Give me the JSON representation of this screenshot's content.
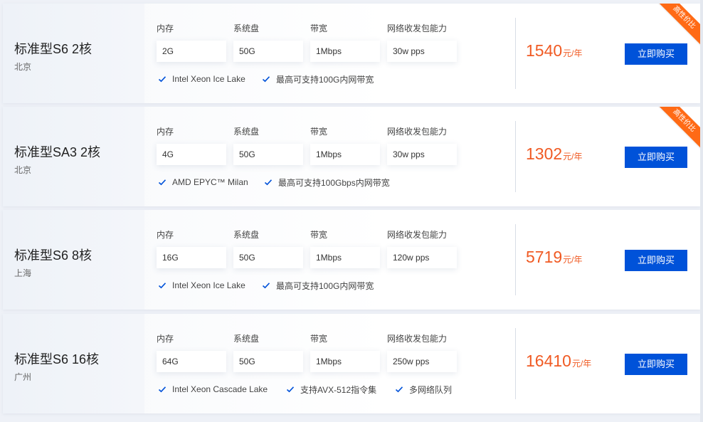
{
  "plans": [
    {
      "name": "标准型S6 2核",
      "region": "北京",
      "specs": [
        {
          "label": "内存",
          "value": "2G"
        },
        {
          "label": "系统盘",
          "value": "50G"
        },
        {
          "label": "带宽",
          "value": "1Mbps"
        },
        {
          "label": "网络收发包能力",
          "value": "30w pps"
        }
      ],
      "features": [
        "Intel Xeon Ice Lake",
        "最高可支持100G内网带宽"
      ],
      "price": "1540",
      "price_unit": "元/年",
      "buy_label": "立即购买",
      "ribbon": "高性价比"
    },
    {
      "name": "标准型SA3 2核",
      "region": "北京",
      "specs": [
        {
          "label": "内存",
          "value": "4G"
        },
        {
          "label": "系统盘",
          "value": "50G"
        },
        {
          "label": "带宽",
          "value": "1Mbps"
        },
        {
          "label": "网络收发包能力",
          "value": "30w pps"
        }
      ],
      "features": [
        "AMD EPYC™ Milan",
        "最高可支持100Gbps内网带宽"
      ],
      "price": "1302",
      "price_unit": "元/年",
      "buy_label": "立即购买",
      "ribbon": "高性价比"
    },
    {
      "name": "标准型S6 8核",
      "region": "上海",
      "specs": [
        {
          "label": "内存",
          "value": "16G"
        },
        {
          "label": "系统盘",
          "value": "50G"
        },
        {
          "label": "带宽",
          "value": "1Mbps"
        },
        {
          "label": "网络收发包能力",
          "value": "120w pps"
        }
      ],
      "features": [
        "Intel Xeon Ice Lake",
        "最高可支持100G内网带宽"
      ],
      "price": "5719",
      "price_unit": "元/年",
      "buy_label": "立即购买",
      "ribbon": ""
    },
    {
      "name": "标准型S6 16核",
      "region": "广州",
      "specs": [
        {
          "label": "内存",
          "value": "64G"
        },
        {
          "label": "系统盘",
          "value": "50G"
        },
        {
          "label": "带宽",
          "value": "1Mbps"
        },
        {
          "label": "网络收发包能力",
          "value": "250w pps"
        }
      ],
      "features": [
        "Intel Xeon Cascade Lake",
        "支持AVX-512指令集",
        "多网络队列"
      ],
      "price": "16410",
      "price_unit": "元/年",
      "buy_label": "立即购买",
      "ribbon": ""
    }
  ],
  "colors": {
    "accent": "#0052d9",
    "price": "#f05a23",
    "ribbon": "#ff6a15",
    "check": "#0052d9"
  },
  "icons": {
    "feature_check": "check-icon"
  }
}
